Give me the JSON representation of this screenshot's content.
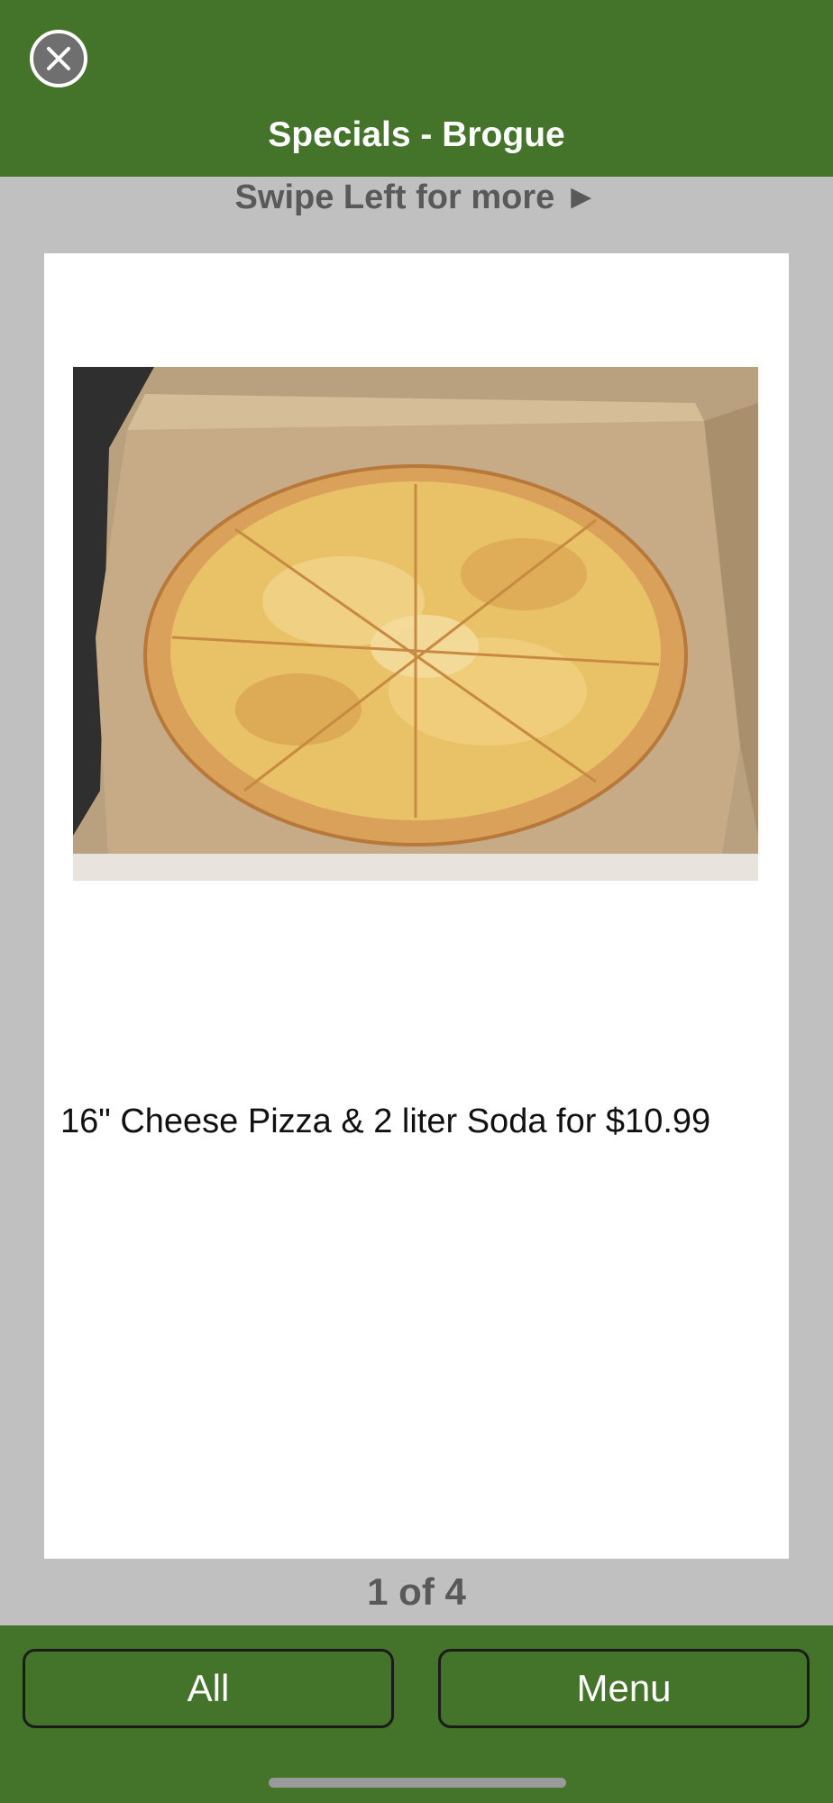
{
  "header": {
    "title": "Specials - Brogue",
    "close_icon": "close-icon"
  },
  "hint": {
    "text": "Swipe Left for more ►"
  },
  "special": {
    "image_icon": "pizza-photo",
    "description": "16\" Cheese Pizza & 2 liter Soda for $10.99"
  },
  "pager": {
    "text": "1 of 4"
  },
  "footer": {
    "all_label": "All",
    "menu_label": "Menu"
  },
  "colors": {
    "brand_green": "#43742a",
    "background_gray": "#c0c0c0",
    "muted_text": "#595959"
  }
}
